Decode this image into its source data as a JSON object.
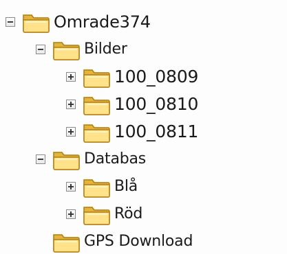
{
  "tree": {
    "root": {
      "label": "Omrade374",
      "expanded": true,
      "children": {
        "bilder": {
          "label": "Bilder",
          "expanded": true,
          "children": [
            {
              "label": "100_0809",
              "expanded": false
            },
            {
              "label": "100_0810",
              "expanded": false
            },
            {
              "label": "100_0811",
              "expanded": false
            }
          ]
        },
        "databas": {
          "label": "Databas",
          "expanded": true,
          "children": [
            {
              "label": "Blå",
              "expanded": false
            },
            {
              "label": "Röd",
              "expanded": false
            }
          ]
        },
        "gps": {
          "label": "GPS Download"
        }
      }
    }
  }
}
